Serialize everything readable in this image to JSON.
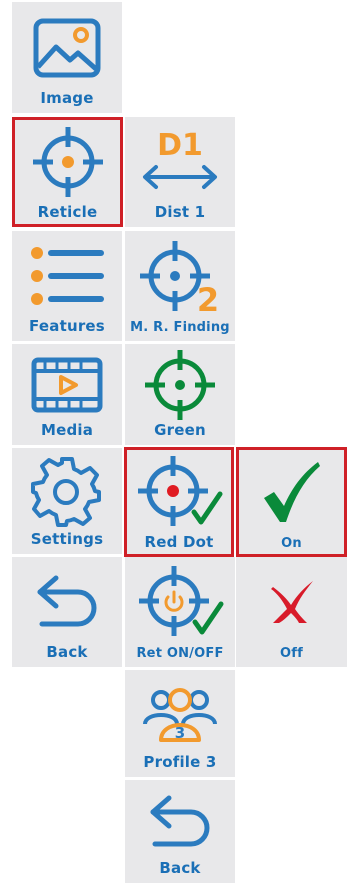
{
  "colors": {
    "tile_bg": "#e8e8ea",
    "accent_blue": "#2b7bbf",
    "accent_orange": "#f29a2e",
    "selected_border": "#cf2027",
    "label_blue": "#1a6fb6",
    "green": "#0a8a3a",
    "red_dot": "#e01b22",
    "red_x": "#d81b2a"
  },
  "menu": {
    "col1": {
      "image": {
        "label": "Image",
        "icon": "image-icon"
      },
      "reticle": {
        "label": "Reticle",
        "icon": "reticle-icon",
        "selected": true
      },
      "features": {
        "label": "Features",
        "icon": "list-icon"
      },
      "media": {
        "label": "Media",
        "icon": "film-icon"
      },
      "settings": {
        "label": "Settings",
        "icon": "gear-icon"
      },
      "back": {
        "label": "Back",
        "icon": "back-arrow-icon"
      }
    },
    "col2": {
      "dist1": {
        "label": "Dist 1",
        "icon": "distance-icon",
        "badge": "D1"
      },
      "mrfinding": {
        "label": "M. R. Finding",
        "icon": "reticle-2-icon",
        "badge": "2"
      },
      "green": {
        "label": "Green",
        "icon": "green-reticle-icon"
      },
      "reddot": {
        "label": "Red Dot",
        "icon": "red-dot-reticle-icon",
        "selected": true
      },
      "retonoff": {
        "label": "Ret ON/OFF",
        "icon": "reticle-power-icon"
      },
      "profile3": {
        "label": "Profile 3",
        "icon": "profile-group-icon",
        "badge": "3"
      },
      "back": {
        "label": "Back",
        "icon": "back-arrow-icon"
      }
    },
    "col3": {
      "on": {
        "label": "On",
        "icon": "checkmark-icon",
        "selected": true
      },
      "off": {
        "label": "Off",
        "icon": "cross-icon"
      }
    }
  }
}
